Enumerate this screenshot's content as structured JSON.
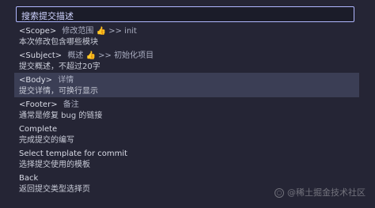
{
  "search": {
    "placeholder": "搜索提交描述"
  },
  "items": [
    {
      "title": "<Scope>",
      "desc": "修改范围 👍 >> init",
      "subtitle": "本次修改包含哪些模块",
      "selected": false
    },
    {
      "title": "<Subject>",
      "desc": "概述 👍 >> 初始化项目",
      "subtitle": "提交概述，不超过20字",
      "selected": false
    },
    {
      "title": "<Body>",
      "desc": "详情",
      "subtitle": "提交详情，可换行显示",
      "selected": true
    },
    {
      "title": "<Footer>",
      "desc": "备注",
      "subtitle": "通常是修复 bug 的链接",
      "selected": false
    },
    {
      "title": "Complete",
      "desc": "",
      "subtitle": "完成提交的编写",
      "selected": false
    },
    {
      "title": "Select template for commit",
      "desc": "",
      "subtitle": "选择提交使用的模板",
      "selected": false
    },
    {
      "title": "Back",
      "desc": "",
      "subtitle": "返回提交类型选择页",
      "selected": false
    }
  ],
  "watermark": {
    "text": "@稀土掘金技术社区"
  },
  "colors": {
    "accent": "#b0b7ff",
    "selected_bg": "#3b3e55"
  }
}
